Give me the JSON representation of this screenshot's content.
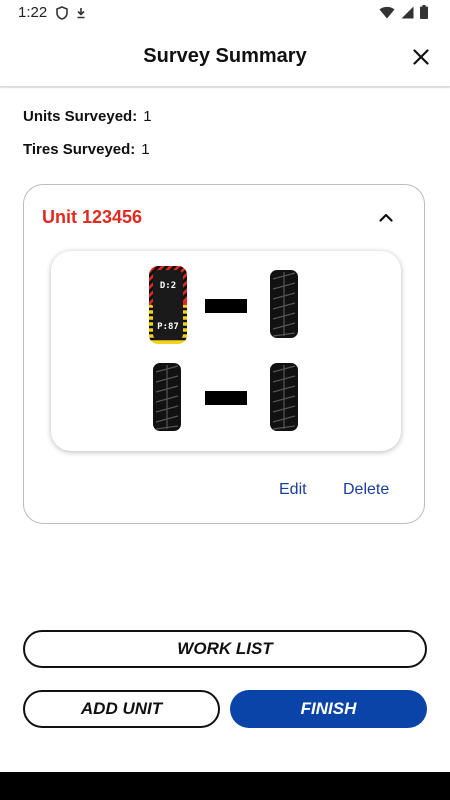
{
  "status_bar": {
    "time": "1:22",
    "left_icons": [
      "shield-icon",
      "download-icon"
    ],
    "right_icons": [
      "wifi-icon",
      "signal-icon",
      "battery-icon"
    ]
  },
  "header": {
    "title": "Survey Summary",
    "close_icon": "close-icon"
  },
  "summary": {
    "units_label": "Units Surveyed:",
    "units_value": "1",
    "tires_label": "Tires Surveyed:",
    "tires_value": "1"
  },
  "unit_card": {
    "title": "Unit 123456",
    "title_color": "#e02a20",
    "collapse_icon": "chevron-up-icon",
    "surveyed_tire": {
      "label_top": "D:2",
      "label_bottom": "P:87",
      "stripe_colors": [
        "#e02a20",
        "#f2d21b"
      ]
    },
    "edit_label": "Edit",
    "delete_label": "Delete"
  },
  "buttons": {
    "work_list": "WORK LIST",
    "add_unit": "ADD UNIT",
    "finish": "FINISH"
  },
  "colors": {
    "primary": "#0b44a8",
    "link": "#1b3f9a"
  }
}
